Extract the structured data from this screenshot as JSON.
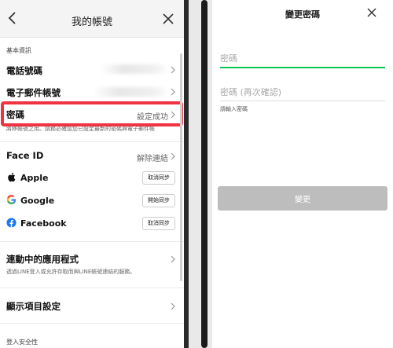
{
  "account_screen": {
    "title": "我的帳號",
    "basic_info_label": "基本資訊",
    "phone_label": "電話號碼",
    "email_label": "電子郵件帳號",
    "password_label": "密碼",
    "password_value": "設定成功",
    "password_note": "將移帳號之用。請務必確認您已設定最新的密碼與電子郵件帳",
    "faceid_label": "Face ID",
    "faceid_value": "解除連結",
    "sso": [
      {
        "name": "Apple",
        "button": "取消同步",
        "icon": "apple-icon"
      },
      {
        "name": "Google",
        "button": "開始同步",
        "icon": "google-icon"
      },
      {
        "name": "Facebook",
        "button": "取消同步",
        "icon": "facebook-icon"
      }
    ],
    "linked_apps_label": "連動中的應用程式",
    "linked_apps_note": "透過LINE登入或允許存取而與LINE帳號連結的服務。",
    "display_settings_label": "顯示項目設定",
    "login_security_label": "登入安全性",
    "colors": {
      "highlight": "#ef3340",
      "google_blue": "#4285F4",
      "facebook_blue": "#1877F2"
    }
  },
  "change_password_screen": {
    "title": "變更密碼",
    "password_placeholder": "密碼",
    "confirm_placeholder": "密碼 (再次確認)",
    "hint": "請輸入密碼",
    "submit_label": "變更",
    "colors": {
      "active_underline": "#06c755",
      "button_disabled": "#bdbdbd"
    }
  }
}
